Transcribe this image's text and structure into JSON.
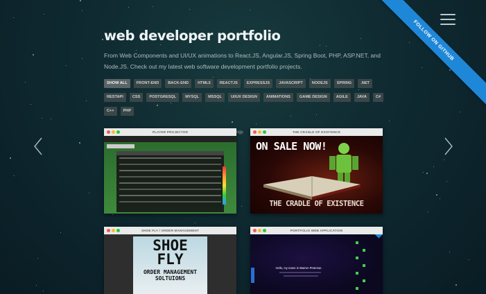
{
  "header": {
    "title": "web developer portfolio",
    "intro": "From Web Components and UI/UX animations to React.JS, Angular.JS, Spring Boot, PHP, ASP.NET, and Node.JS. Check out my latest web software development portfolio projects.",
    "ribbon": "FOLLOW ON GITHUB"
  },
  "filters": [
    "SHOW ALL",
    "FRONT-END",
    "BACK-END",
    "HTML5",
    "REACTJS",
    "EXPRESSJS",
    "JAVASCRIPT",
    "NODEJS",
    "SPRING",
    ".NET",
    "RESTAPI",
    "CSS",
    "POSTGRESQL",
    "MYSQL",
    "MSSQL",
    "UI/UX DESIGN",
    "ANIMATIONS",
    "GAME DESIGN",
    "AGILE",
    "JAVA",
    "C#",
    "C++",
    "PHP"
  ],
  "caption": "Showing all projects using. Use the filter to list them by skill or technology.",
  "projects": [
    {
      "title": "PLAYER PROJECTOR"
    },
    {
      "title": "THE CRADLE OF EXISTENCE",
      "banner_top": "ON SALE NOW!",
      "banner_bottom": "THE CRADLE OF EXISTENCE"
    },
    {
      "title": "SHOE FLY / ORDER MANAGEMENT",
      "logo": "SHOE FLY",
      "tagline": "ORDER MANAGEMENT SOLTUIONS"
    },
    {
      "title": "PORTFOLIO WEB APPLICATION",
      "greeting": "Hello, my name is Warren Peterson."
    }
  ],
  "icons": [
    "menu-icon",
    "chevron-left-icon",
    "chevron-right-icon"
  ],
  "colors": {
    "ribbon": "#1f87d8",
    "background": "#0f2a31",
    "chip": "#3a4648"
  }
}
